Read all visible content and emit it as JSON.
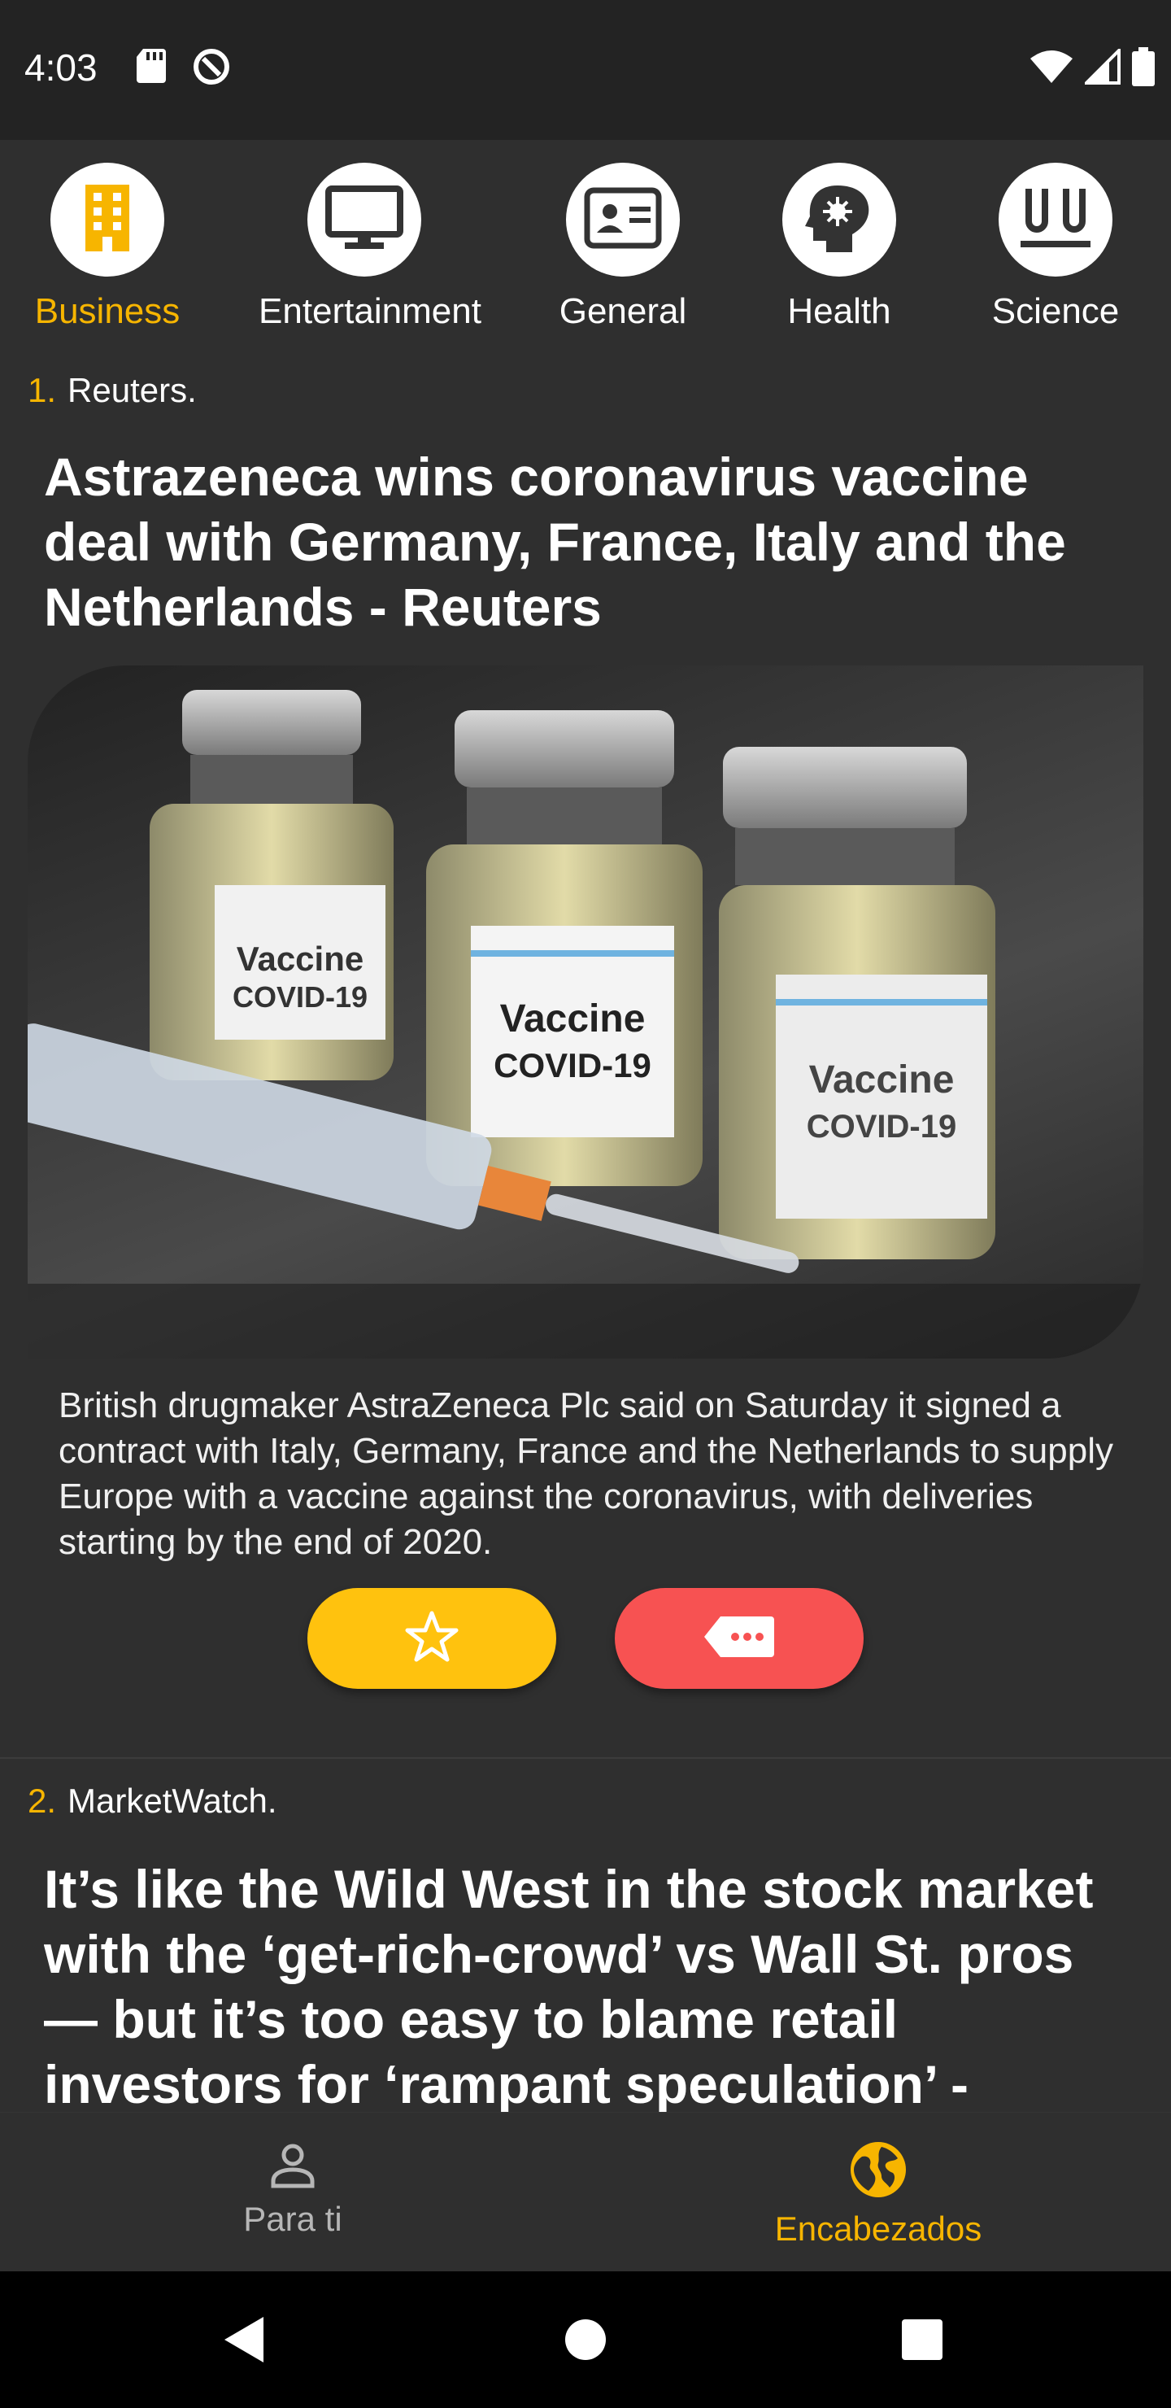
{
  "status_bar": {
    "time": "4:03"
  },
  "categories": [
    {
      "label": "Business",
      "icon": "building-icon",
      "active": true
    },
    {
      "label": "Entertainment",
      "icon": "monitor-icon",
      "active": false
    },
    {
      "label": "General",
      "icon": "id-card-icon",
      "active": false
    },
    {
      "label": "Health",
      "icon": "head-virus-icon",
      "active": false
    },
    {
      "label": "Science",
      "icon": "test-tubes-icon",
      "active": false
    }
  ],
  "articles": [
    {
      "index": "1.",
      "source": "Reuters.",
      "title": "Astrazeneca wins coronavirus vaccine deal with Germany, France, Italy and the Netherlands - Reuters",
      "summary": "British drugmaker AstraZeneca Plc said on Saturday it signed a contract with Italy, Germany, France and the Netherlands to supply Europe with a vaccine against the coronavirus, with deliveries starting by the end of 2020.",
      "image_vial_label": "Vaccine COVID-19"
    },
    {
      "index": "2.",
      "source": "MarketWatch.",
      "title": "It’s like the Wild West in the stock market with the ‘get-rich-crowd’ vs Wall St. pros — but it’s too easy to blame retail investors for ‘rampant speculation’ -"
    }
  ],
  "bottom_nav": [
    {
      "label": "Para ti",
      "icon": "person-icon",
      "active": false
    },
    {
      "label": "Encabezados",
      "icon": "globe-icon",
      "active": true
    }
  ],
  "colors": {
    "accent": "#f7b500",
    "favorite": "#ffc20e",
    "comments": "#f75252",
    "background": "#2f2f2f"
  }
}
